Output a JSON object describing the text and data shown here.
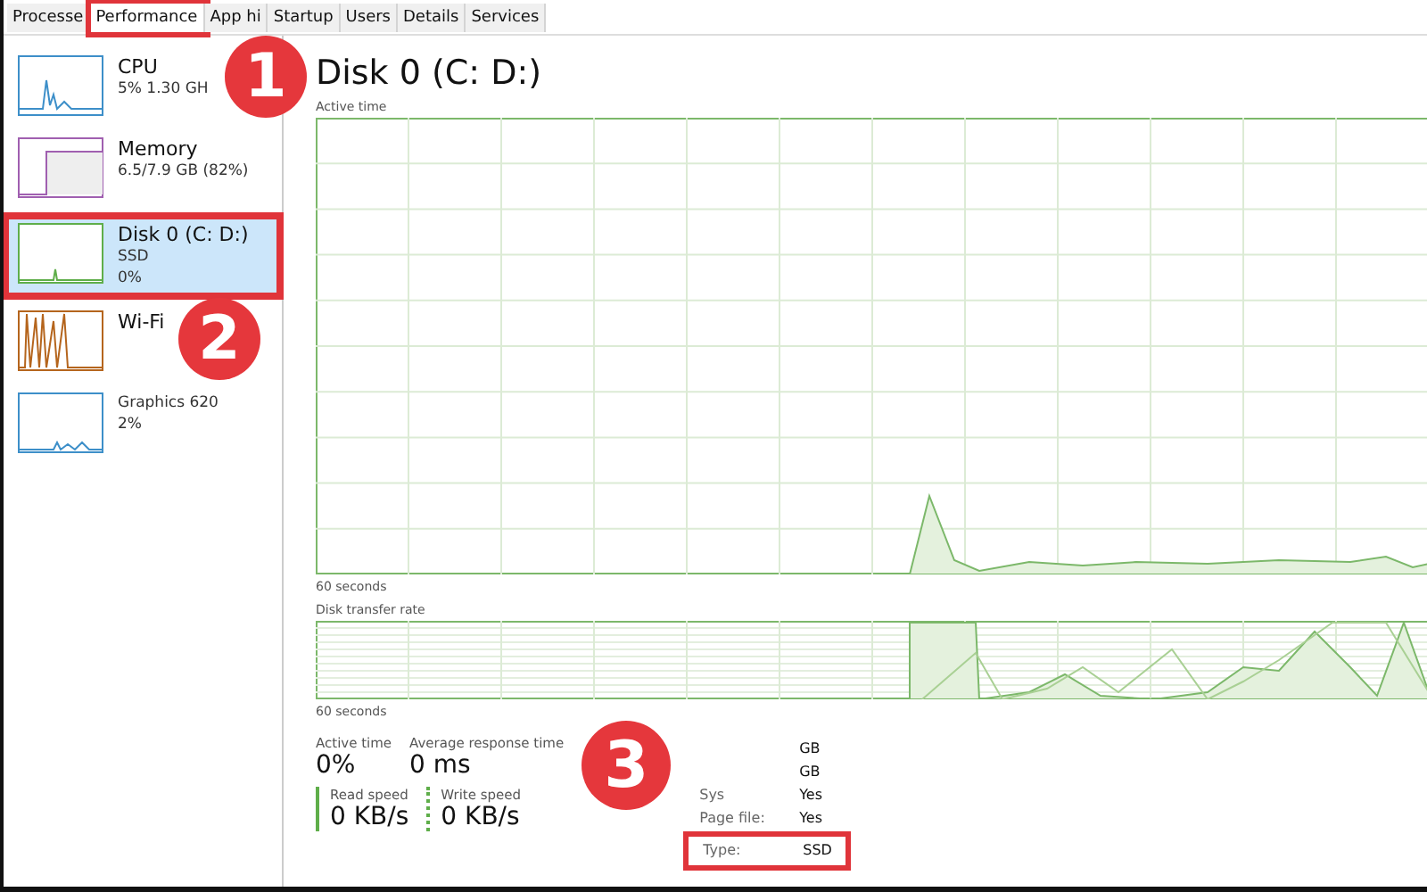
{
  "tabs": [
    {
      "label": "Processe",
      "selected": false,
      "highlighted": false
    },
    {
      "label": "Performance",
      "selected": true,
      "highlighted": true
    },
    {
      "label": "App hi",
      "selected": false,
      "highlighted": false
    },
    {
      "label": "Startup",
      "selected": false,
      "highlighted": false
    },
    {
      "label": "Users",
      "selected": false,
      "highlighted": false
    },
    {
      "label": "Details",
      "selected": false,
      "highlighted": false
    },
    {
      "label": "Services",
      "selected": false,
      "highlighted": false
    }
  ],
  "sidebar": {
    "items": [
      {
        "kind": "cpu",
        "name": "CPU",
        "lines": [
          "5% 1.30 GH"
        ],
        "color": "#3d8fc9",
        "selected": false,
        "highlighted": false
      },
      {
        "kind": "memory",
        "name": "Memory",
        "lines": [
          "6.5/7.9 GB (82%)"
        ],
        "color": "#a05fb0",
        "selected": false,
        "highlighted": false
      },
      {
        "kind": "disk",
        "name": "Disk 0 (C: D:)",
        "lines": [
          "SSD",
          "0%"
        ],
        "color": "#5fae4a",
        "selected": true,
        "highlighted": true
      },
      {
        "kind": "wifi",
        "name": "Wi-Fi",
        "color": "#b5651d",
        "selected": false,
        "highlighted": false
      },
      {
        "kind": "gpu",
        "lines": [
          "Graphics 620",
          "2%"
        ],
        "color": "#3d8fc9",
        "selected": false,
        "highlighted": false
      }
    ]
  },
  "main": {
    "title": "Disk 0 (C: D:)",
    "active_chart": {
      "label": "Active time",
      "footer": "60 seconds"
    },
    "transfer_chart": {
      "label": "Disk transfer rate",
      "footer": "60 seconds"
    },
    "stats": [
      {
        "label": "Active time",
        "value": "0%"
      },
      {
        "label": "Average response time",
        "value": "0 ms"
      }
    ],
    "speeds": [
      {
        "kind": "read",
        "label": "Read speed",
        "value": "0 KB/s"
      },
      {
        "kind": "write",
        "label": "Write speed",
        "value": "0 KB/s"
      }
    ],
    "details": [
      {
        "value": "GB",
        "highlighted": false
      },
      {
        "value": "GB",
        "highlighted": false
      },
      {
        "label": "Sys",
        "value": "Yes",
        "highlighted": false
      },
      {
        "label": "Page file:",
        "value": "Yes",
        "highlighted": false
      },
      {
        "label": "Type:",
        "value": "SSD",
        "highlighted": true
      }
    ]
  },
  "callouts": [
    {
      "number": "1"
    },
    {
      "number": "2"
    },
    {
      "number": "3"
    }
  ]
}
